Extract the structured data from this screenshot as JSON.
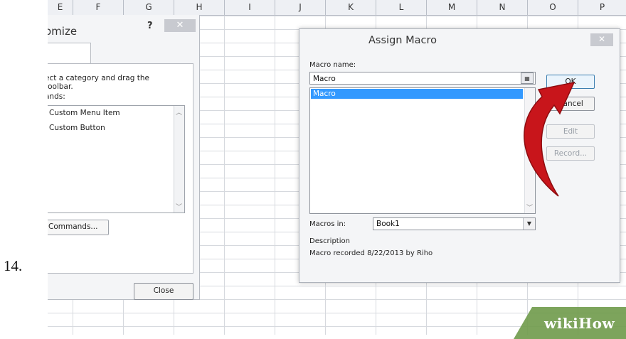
{
  "step_number": "14.",
  "spreadsheet": {
    "column_headers": [
      "E",
      "F",
      "G",
      "H",
      "I",
      "J",
      "K",
      "L",
      "M",
      "N",
      "O",
      "P"
    ]
  },
  "customize_dialog": {
    "title": "omize",
    "help": "?",
    "close": "✕",
    "instructions_line1": "ect a category and drag the",
    "instructions_line2": "toolbar.",
    "commands_label": "ands:",
    "list_items": [
      "Custom Menu Item",
      "Custom Button"
    ],
    "commands_button": "Commands...",
    "close_button": "Close"
  },
  "assign_macro": {
    "title": "Assign Macro",
    "close": "✕",
    "macro_name_label": "Macro name:",
    "macro_name_value": "Macro",
    "macro_list": [
      "Macro"
    ],
    "buttons": {
      "ok": "OK",
      "cancel": "Cancel",
      "edit": "Edit",
      "record": "Record..."
    },
    "macros_in_label": "Macros in:",
    "macros_in_value": "Book1",
    "description_label": "Description",
    "description_text": "Macro recorded 8/22/2013 by Riho"
  },
  "watermark": "wikiHow",
  "colors": {
    "selection": "#3399ff",
    "arrow": "#c8151b",
    "watermark_bg": "#6f9a4a"
  }
}
